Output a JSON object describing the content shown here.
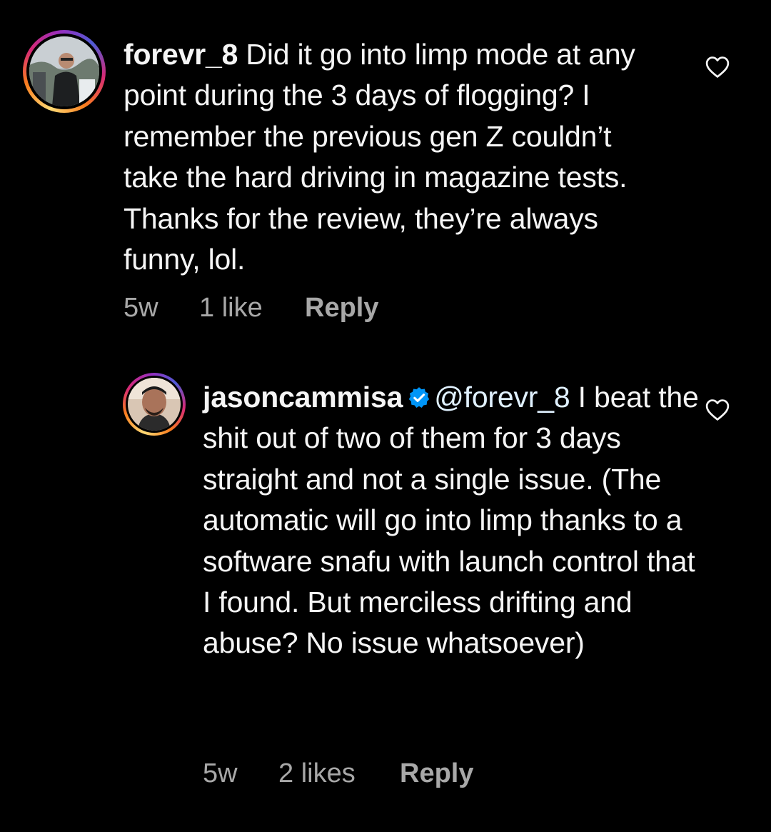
{
  "comments": [
    {
      "username": "forevr_8",
      "text": "Did it go into limp mode at any point during the 3 days of flogging? I remember the previous gen Z couldn’t take the hard driving in magazine tests. Thanks for the review, they’re always funny, lol.",
      "time": "5w",
      "likes": "1 like",
      "reply_label": "Reply",
      "verified": false
    },
    {
      "username": "jasoncammisa",
      "mention": "@forevr_8",
      "text": "I beat the shit out of two of them for 3 days straight and not a single issue. (The automatic will go into limp thanks to a software snafu with launch control that I found. But merciless drifting and abuse? No issue whatsoever)",
      "time": "5w",
      "likes": "2 likes",
      "reply_label": "Reply",
      "verified": true
    }
  ],
  "colors": {
    "background": "#000000",
    "text": "#f5f5f5",
    "meta": "#a8a8a8",
    "verified_badge": "#0095f6"
  },
  "icons": {
    "like": "heart-outline-icon",
    "verified": "verified-badge-icon"
  }
}
